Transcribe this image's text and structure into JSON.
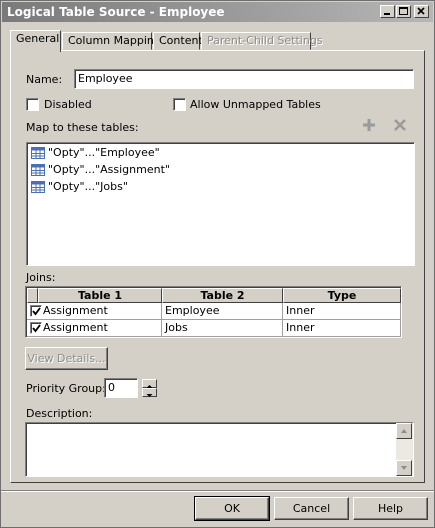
{
  "window": {
    "title": "Logical Table Source - Employee"
  },
  "tabs": [
    {
      "label": "General"
    },
    {
      "label": "Column Mapping"
    },
    {
      "label": "Content"
    },
    {
      "label": "Parent-Child Settings"
    }
  ],
  "general": {
    "name_label": "Name:",
    "name_value": "Employee",
    "disabled_label": "Disabled",
    "disabled_checked": false,
    "allow_unmapped_label": "Allow Unmapped Tables",
    "allow_unmapped_checked": false,
    "map_label": "Map to these tables:",
    "tables": [
      {
        "label": "\"Opty\"...\"Employee\""
      },
      {
        "label": "\"Opty\"...\"Assignment\""
      },
      {
        "label": "\"Opty\"...\"Jobs\""
      }
    ],
    "joins_label": "Joins:",
    "joins_columns": [
      "Table 1",
      "Table 2",
      "Type"
    ],
    "joins_rows": [
      {
        "checked": true,
        "table1": "Assignment",
        "table2": "Employee",
        "type": "Inner"
      },
      {
        "checked": true,
        "table1": "Assignment",
        "table2": "Jobs",
        "type": "Inner"
      }
    ],
    "view_details_label": "View Details...",
    "priority_label": "Priority Group:",
    "priority_value": "0",
    "description_label": "Description:",
    "description_value": ""
  },
  "footer": {
    "ok_label": "OK",
    "cancel_label": "Cancel",
    "help_label": "Help"
  },
  "colors": {
    "titlebar_start": "#7a7a7a",
    "dialog_bg": "#d4d0c8",
    "disabled_text": "#8d8d8d",
    "table_icon": "#4a6fb5"
  }
}
